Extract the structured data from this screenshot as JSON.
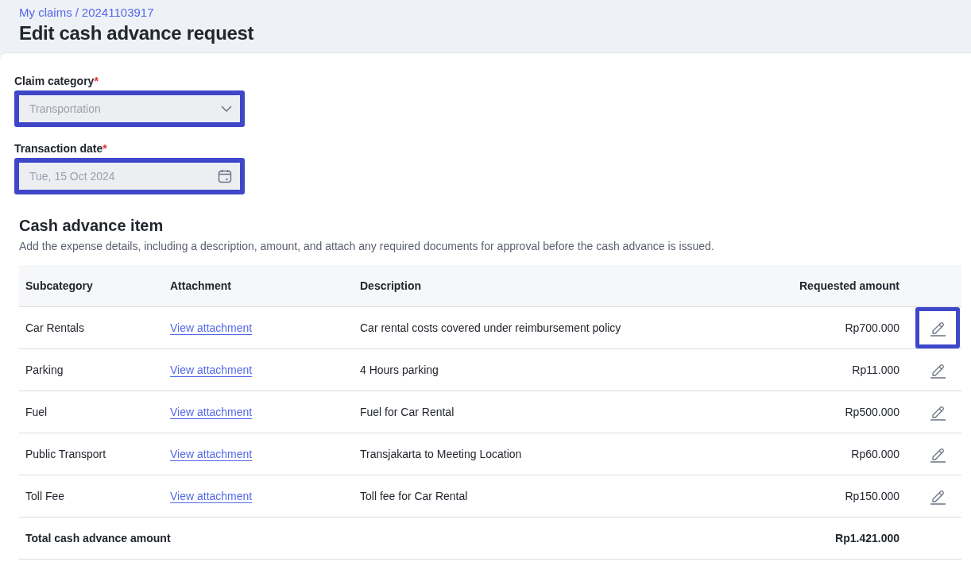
{
  "breadcrumb": {
    "parent": "My claims",
    "separator": "/",
    "current": "20241103917"
  },
  "title": "Edit cash advance request",
  "fields": [
    {
      "kind": "select",
      "label": "Claim category",
      "required_mark": "*",
      "value": "Transportation",
      "disabled": true,
      "highlighted": true
    },
    {
      "kind": "date",
      "label": "Transaction date",
      "required_mark": "*",
      "value": "Tue, 15 Oct 2024",
      "disabled": true,
      "highlighted": true
    }
  ],
  "section": {
    "title": "Cash advance item",
    "description": "Add the expense details, including a description, amount, and attach any required documents for approval before the cash advance is issued."
  },
  "table": {
    "columns": [
      "Subcategory",
      "Attachment",
      "Description",
      "Requested amount"
    ],
    "rows": [
      {
        "subcategory": "Car Rentals",
        "attachment": "View attachment",
        "description": "Car rental costs covered under reimbursement policy",
        "amount": "Rp700.000",
        "edit_highlighted": true
      },
      {
        "subcategory": "Parking",
        "attachment": "View attachment",
        "description": "4 Hours parking",
        "amount": "Rp11.000",
        "edit_highlighted": false
      },
      {
        "subcategory": "Fuel",
        "attachment": "View attachment",
        "description": "Fuel for Car Rental",
        "amount": "Rp500.000",
        "edit_highlighted": false
      },
      {
        "subcategory": "Public Transport",
        "attachment": "View attachment",
        "description": "Transjakarta to Meeting Location",
        "amount": "Rp60.000",
        "edit_highlighted": false
      },
      {
        "subcategory": "Toll Fee",
        "attachment": "View attachment",
        "description": "Toll fee for Car Rental",
        "amount": "Rp150.000",
        "edit_highlighted": false
      }
    ],
    "total": {
      "label": "Total cash advance amount",
      "amount": "Rp1.421.000"
    }
  }
}
